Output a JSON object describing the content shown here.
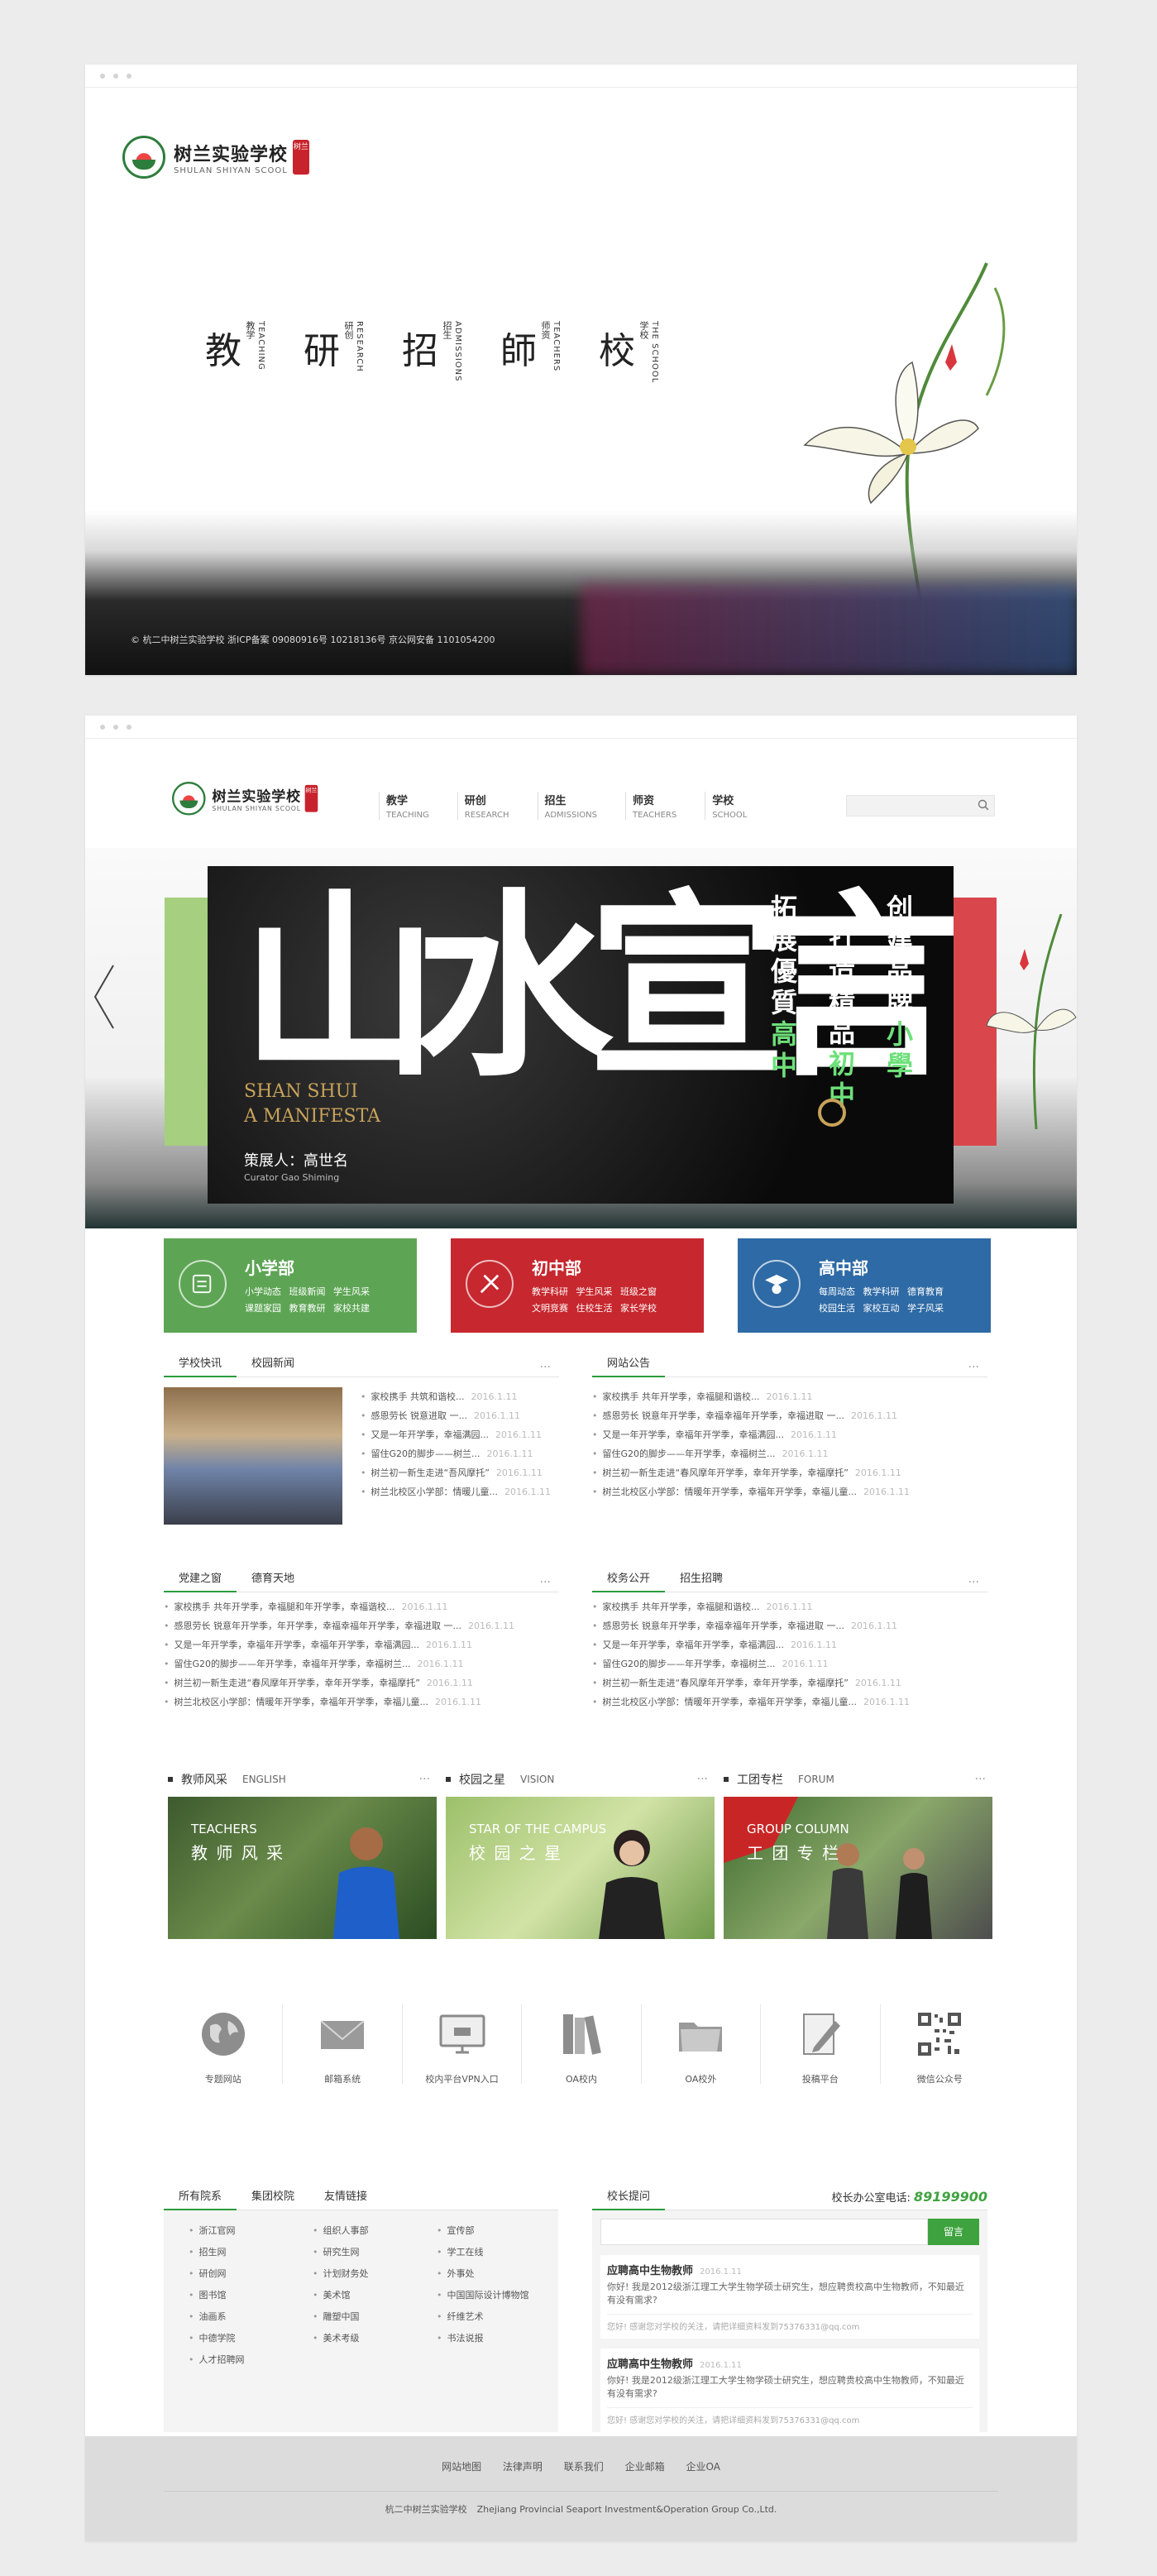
{
  "screen1": {
    "logo": {
      "cn": "树兰实验学校",
      "en": "SHULAN SHIYAN SCOOL",
      "seal": "树兰"
    },
    "nav": [
      {
        "char": "教",
        "zh": "教学",
        "en": "TEACHING"
      },
      {
        "char": "研",
        "zh": "研创",
        "en": "RESEARCH"
      },
      {
        "char": "招",
        "zh": "招生",
        "en": "ADMISSIONS"
      },
      {
        "char": "師",
        "zh": "师资",
        "en": "TEACHERS"
      },
      {
        "char": "校",
        "zh": "学校",
        "en": "THE SCHOOL"
      }
    ],
    "copyright": "© 杭二中树兰实验学校 浙ICP备案 09080916号 10218136号 京公网安备 1101054200"
  },
  "header": {
    "logo": {
      "cn": "树兰实验学校",
      "en": "SHULAN SHIYAN SCOOL",
      "seal": "树兰"
    },
    "nav": [
      {
        "zh": "教学",
        "en": "TEACHING"
      },
      {
        "zh": "研创",
        "en": "RESEARCH"
      },
      {
        "zh": "招生",
        "en": "ADMISSIONS"
      },
      {
        "zh": "师资",
        "en": "TEACHERS"
      },
      {
        "zh": "学校",
        "en": "SCHOOL"
      }
    ]
  },
  "banner": {
    "big": "山水宣言",
    "en1": "SHAN SHUI",
    "en2": "A MANIFESTA",
    "curator": "策展人：高世名",
    "curator_en": "Curator Gao Shiming",
    "col1_a": "拓展優質",
    "col1_b": "高中",
    "col2_a": "打造精品",
    "col2_b": "初中",
    "col3_a": "创建品牌",
    "col3_b": "小學"
  },
  "depts": [
    {
      "name": "小学部",
      "line1": "小学动态 班级新闻 学生风采",
      "line2": "课题家园 教育教研 家校共建",
      "color": "#5da554"
    },
    {
      "name": "初中部",
      "line1": "教学科研 学生风采 班级之窗",
      "line2": "文明竞赛 住校生活 家长学校",
      "color": "#c7272e"
    },
    {
      "name": "高中部",
      "line1": "每周动态 教学科研 德育教育",
      "line2": "校园生活 家校互动 学子风采",
      "color": "#2e6aa5"
    }
  ],
  "news1": {
    "tabs": [
      "学校快讯",
      "校园新闻"
    ],
    "more": "···",
    "items": [
      {
        "t": "家校携手 共筑和谐校...",
        "d": "2016.1.11"
      },
      {
        "t": "感恩劳长 锐意进取 一...",
        "d": "2016.1.11"
      },
      {
        "t": "又是一年开学季，幸福满园...",
        "d": "2016.1.11"
      },
      {
        "t": "留住G20的脚步——树兰...",
        "d": "2016.1.11"
      },
      {
        "t": "树兰初一新生走进“吾风摩托”",
        "d": "2016.1.11"
      },
      {
        "t": "树兰北校区小学部：情暖儿童...",
        "d": "2016.1.11"
      }
    ]
  },
  "news2": {
    "tabs": [
      "网站公告"
    ],
    "more": "···",
    "items": [
      {
        "t": "家校携手 共年开学季，幸福腿和谐校...",
        "d": "2016.1.11"
      },
      {
        "t": "感恩劳长 锐意年开学季，幸福幸福年开学季，幸福进取 一...",
        "d": "2016.1.11"
      },
      {
        "t": "又是一年开学季，幸福年开学季，幸福满园...",
        "d": "2016.1.11"
      },
      {
        "t": "留住G20的脚步——年开学季，幸福树兰...",
        "d": "2016.1.11"
      },
      {
        "t": "树兰初一新生走进“春风摩年开学季，幸年开学季，幸福摩托”",
        "d": "2016.1.11"
      },
      {
        "t": "树兰北校区小学部：情暖年开学季，幸福年开学季，幸福儿童...",
        "d": "2016.1.11"
      }
    ]
  },
  "news3": {
    "tabs": [
      "党建之窗",
      "德育天地"
    ],
    "more": "···",
    "items": [
      {
        "t": "家校携手 共年开学季，幸福腿和年开学季，幸福谐校...",
        "d": "2016.1.11"
      },
      {
        "t": "感恩劳长 锐意年开学季，年开学季，幸福幸福年开学季，幸福进取 一...",
        "d": "2016.1.11"
      },
      {
        "t": "又是一年开学季，幸福年开学季，幸福年开学季，幸福满园...",
        "d": "2016.1.11"
      },
      {
        "t": "留住G20的脚步——年开学季，幸福年开学季，幸福树兰...",
        "d": "2016.1.11"
      },
      {
        "t": "树兰初一新生走进“春风摩年开学季，幸年开学季，幸福摩托”",
        "d": "2016.1.11"
      },
      {
        "t": "树兰北校区小学部：情暖年开学季，幸福年开学季，幸福儿童...",
        "d": "2016.1.11"
      }
    ]
  },
  "news4": {
    "tabs": [
      "校务公开",
      "招生招聘"
    ],
    "more": "···",
    "items": [
      {
        "t": "家校携手 共年开学季，幸福腿和谐校...",
        "d": "2016.1.11"
      },
      {
        "t": "感恩劳长 锐意年开学季，幸福幸福年开学季，幸福进取 一...",
        "d": "2016.1.11"
      },
      {
        "t": "又是一年开学季，幸福年开学季，幸福满园...",
        "d": "2016.1.11"
      },
      {
        "t": "留住G20的脚步——年开学季，幸福树兰...",
        "d": "2016.1.11"
      },
      {
        "t": "树兰初一新生走进“春风摩年开学季，幸年开学季，幸福摩托”",
        "d": "2016.1.11"
      },
      {
        "t": "树兰北校区小学部：情暖年开学季，幸福年开学季，幸福儿童...",
        "d": "2016.1.11"
      }
    ]
  },
  "showcase": [
    {
      "title": "教师风采",
      "en": "ENGLISH",
      "pic_en": "TEACHERS",
      "pic_cn": "教 师 风 采",
      "more": "···"
    },
    {
      "title": "校园之星",
      "en": "VISION",
      "pic_en": "STAR OF THE CAMPUS",
      "pic_cn": "校 园 之 星",
      "more": "···"
    },
    {
      "title": "工团专栏",
      "en": "FORUM",
      "pic_en": "GROUP COLUMN",
      "pic_cn": "工 团 专 栏",
      "more": "···"
    }
  ],
  "systems": [
    {
      "label": "专题网站",
      "icon": "globe-icon"
    },
    {
      "label": "邮箱系统",
      "icon": "mail-icon"
    },
    {
      "label": "校内平台VPN入口",
      "icon": "monitor-icon"
    },
    {
      "label": "OA校内",
      "icon": "books-icon"
    },
    {
      "label": "OA校外",
      "icon": "folder-icon"
    },
    {
      "label": "投稿平台",
      "icon": "edit-icon"
    },
    {
      "label": "微信公众号",
      "icon": "qrcode-icon"
    }
  ],
  "links": {
    "tabs": [
      "所有院系",
      "集团校院",
      "友情链接"
    ],
    "items": [
      "浙江官网",
      "组织人事部",
      "宣传部",
      "招生网",
      "研究生网",
      "学工在线",
      "研创网",
      "计划财务处",
      "外事处",
      "图书馆",
      "美术馆",
      "中国国际设计博物馆",
      "油画系",
      "雕塑中国",
      "纤维艺术",
      "中德学院",
      "美术考级",
      "书法说报",
      "人才招聘网"
    ]
  },
  "mailbox": {
    "title": "校长提问",
    "phone_label": "校长办公室电话:",
    "phone": "89199900",
    "button": "留言",
    "questions": [
      {
        "title": "应聘高中生物教师",
        "date": "2016.1.11",
        "body": "你好! 我是2012级浙江理工大学生物学硕士研究生，想应聘贵校高中生物教师，不知最近有没有需求?",
        "reply": "您好! 感谢您对学校的关注，请把详细资料发到75376331@qq.com"
      },
      {
        "title": "应聘高中生物教师",
        "date": "2016.1.11",
        "body": "你好! 我是2012级浙江理工大学生物学硕士研究生，想应聘贵校高中生物教师，不知最近有没有需求?",
        "reply": "您好! 感谢您对学校的关注，请把详细资料发到75376331@qq.com"
      }
    ]
  },
  "footer": {
    "links": [
      "网站地图",
      "法律声明",
      "联系我们",
      "企业邮箱",
      "企业OA"
    ],
    "school": "杭二中树兰实验学校",
    "group": "Zhejiang Provincial Seaport Investment&Operation Group Co.,Ltd."
  }
}
